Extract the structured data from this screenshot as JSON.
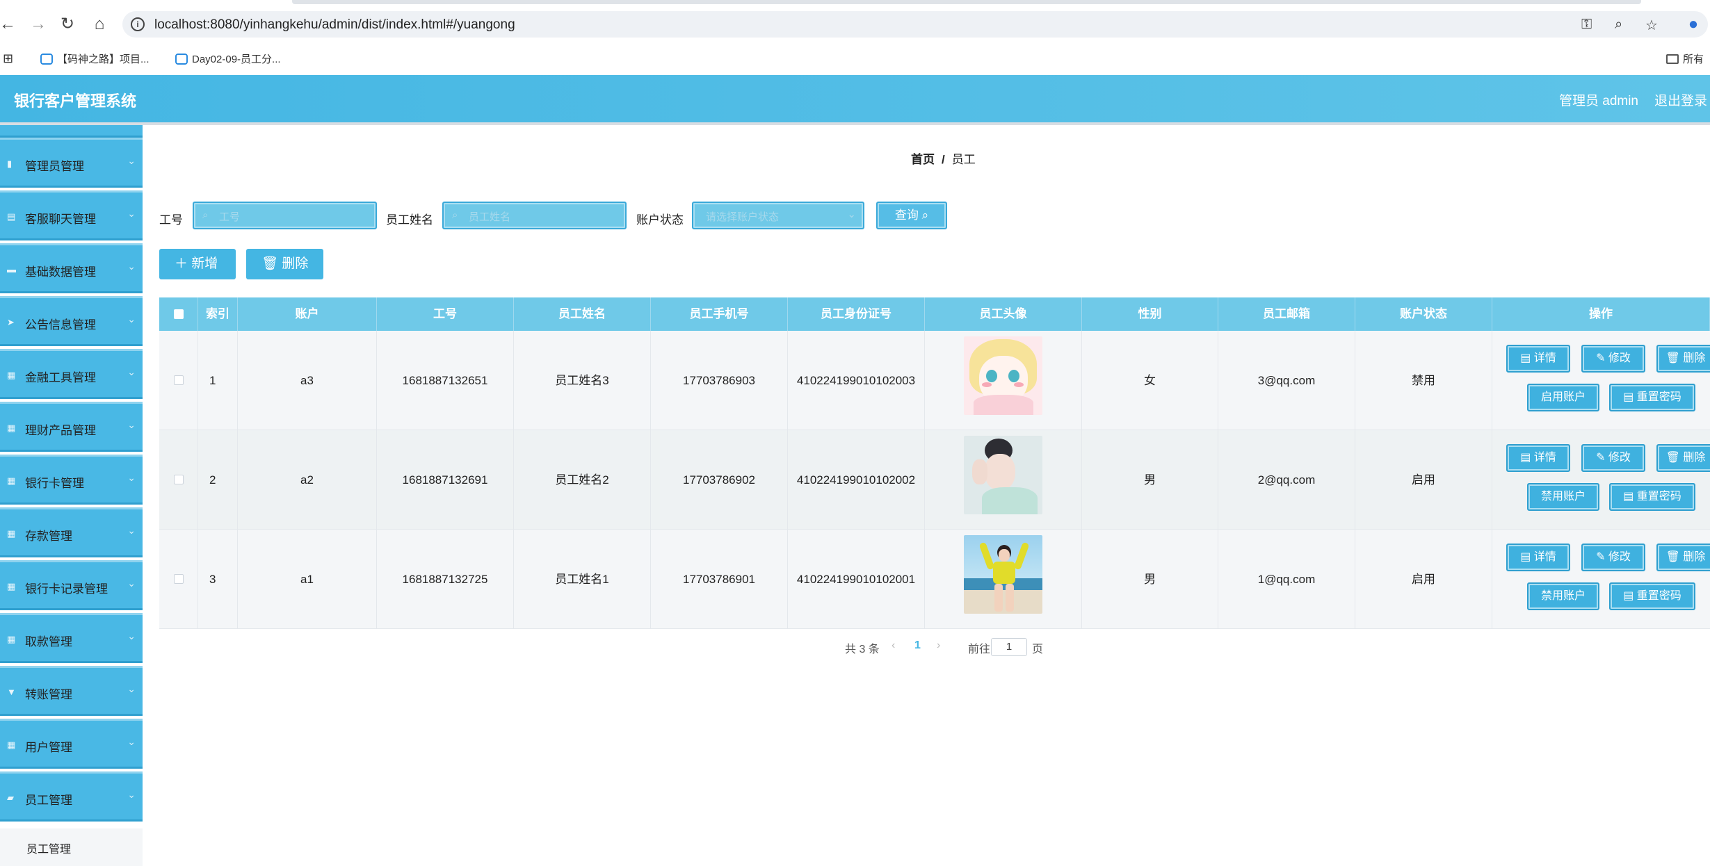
{
  "browser": {
    "url": "localhost:8080/yinhangkehu/admin/dist/index.html#/yuangong",
    "bookmarks": [
      "【码神之路】项目...",
      "Day02-09-员工分..."
    ],
    "bookmarks_right": "所有"
  },
  "header": {
    "title": "银行客户管理系统",
    "user": "管理员 admin",
    "logout": "退出登录"
  },
  "sidebar": {
    "items": [
      {
        "label": "管理员管理",
        "icon": "bar-chart-icon"
      },
      {
        "label": "客服聊天管理",
        "icon": "document-icon"
      },
      {
        "label": "基础数据管理",
        "icon": "briefcase-icon"
      },
      {
        "label": "公告信息管理",
        "icon": "send-icon"
      },
      {
        "label": "金融工具管理",
        "icon": "grid-icon"
      },
      {
        "label": "理财产品管理",
        "icon": "grid-icon"
      },
      {
        "label": "银行卡管理",
        "icon": "grid-icon"
      },
      {
        "label": "存款管理",
        "icon": "grid-icon"
      },
      {
        "label": "银行卡记录管理",
        "icon": "grid-icon"
      },
      {
        "label": "取款管理",
        "icon": "grid-icon"
      },
      {
        "label": "转账管理",
        "icon": "goblet-icon"
      },
      {
        "label": "用户管理",
        "icon": "grid-icon"
      },
      {
        "label": "员工管理",
        "icon": "thumb-icon"
      }
    ],
    "sub_item": "员工管理"
  },
  "breadcrumb": {
    "home": "首页",
    "separator": "/",
    "current": "员工"
  },
  "search": {
    "fields": [
      {
        "label": "工号",
        "placeholder": "工号"
      },
      {
        "label": "员工姓名",
        "placeholder": "员工姓名"
      },
      {
        "label": "账户状态",
        "placeholder": "请选择账户状态"
      }
    ],
    "query_label": "查询"
  },
  "actions": {
    "add": "新增",
    "delete": "删除"
  },
  "table": {
    "columns": [
      "索引",
      "账户",
      "工号",
      "员工姓名",
      "员工手机号",
      "员工身份证号",
      "员工头像",
      "性别",
      "员工邮箱",
      "账户状态",
      "操作"
    ],
    "rows": [
      {
        "index": "1",
        "account": "a3",
        "emp_no": "1681887132651",
        "name": "员工姓名3",
        "phone": "17703786903",
        "id_card": "410224199010102003",
        "gender": "女",
        "email": "3@qq.com",
        "status": "禁用",
        "toggle_label": "启用账户",
        "avatar": "cartoon"
      },
      {
        "index": "2",
        "account": "a2",
        "emp_no": "1681887132691",
        "name": "员工姓名2",
        "phone": "17703786902",
        "id_card": "410224199010102002",
        "gender": "男",
        "email": "2@qq.com",
        "status": "启用",
        "toggle_label": "禁用账户",
        "avatar": "portrait"
      },
      {
        "index": "3",
        "account": "a1",
        "emp_no": "1681887132725",
        "name": "员工姓名1",
        "phone": "17703786901",
        "id_card": "410224199010102001",
        "gender": "男",
        "email": "1@qq.com",
        "status": "启用",
        "toggle_label": "禁用账户",
        "avatar": "beach"
      }
    ],
    "op_labels": {
      "detail": "详情",
      "edit": "修改",
      "delete": "删除",
      "reset": "重置密码"
    }
  },
  "pagination": {
    "total": "共 3 条",
    "current": "1",
    "goto_prefix": "前往",
    "goto_value": "1",
    "goto_suffix": "页"
  },
  "colors": {
    "primary": "#44b6e3",
    "header": "#4fbbe6",
    "table_head": "#6fc9e8"
  }
}
